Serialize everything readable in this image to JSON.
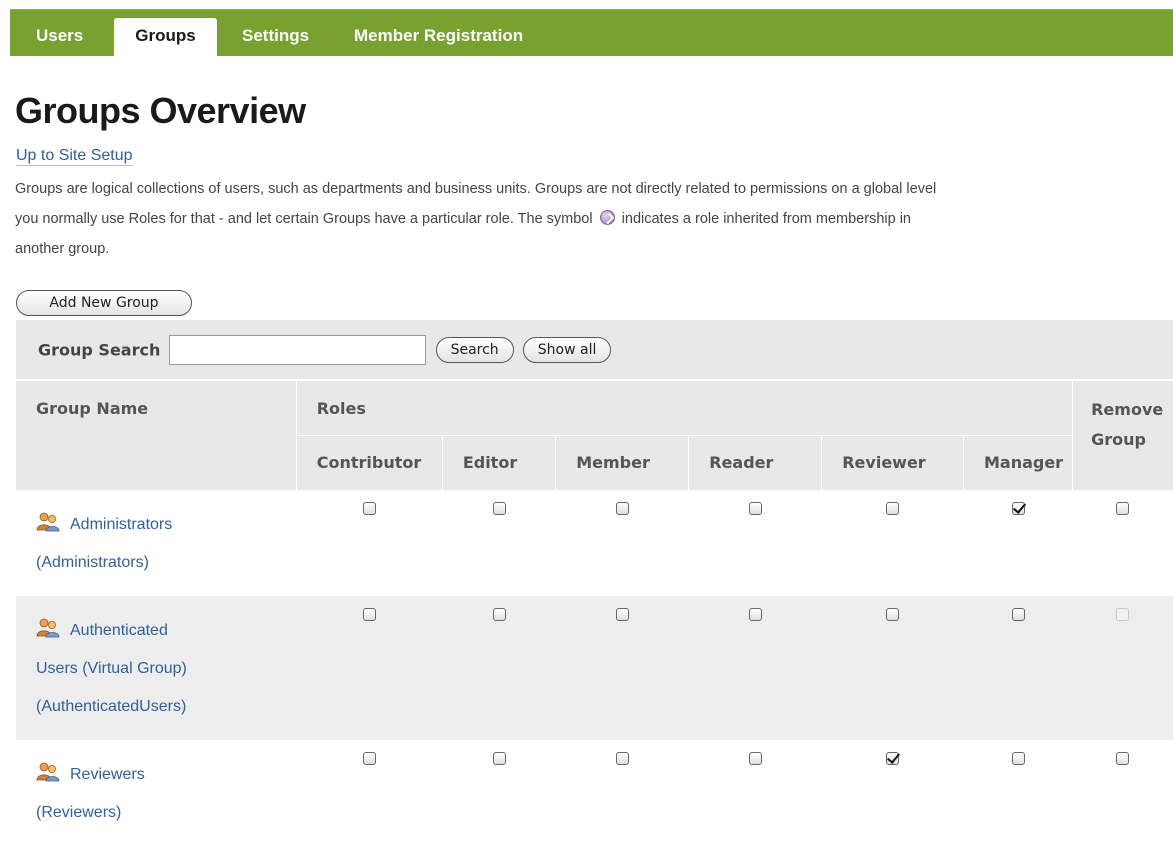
{
  "tabs": [
    {
      "label": "Users",
      "active": false
    },
    {
      "label": "Groups",
      "active": true
    },
    {
      "label": "Settings",
      "active": false
    },
    {
      "label": "Member Registration",
      "active": false
    }
  ],
  "page_title": "Groups Overview",
  "up_link": "Up to Site Setup",
  "description": {
    "line1": "Groups are logical collections of users, such as departments and business units. Groups are not directly related to permissions on a global level",
    "line2a": "you normally use Roles for that - and let certain Groups have a particular role. The symbol",
    "line2b": "indicates a role inherited from membership in",
    "line3": "another group."
  },
  "add_group_button": "Add New Group",
  "search": {
    "label": "Group Search",
    "value": "",
    "search_button": "Search",
    "show_all_button": "Show all"
  },
  "table": {
    "col_group_name": "Group Name",
    "col_roles": "Roles",
    "col_remove": "Remove Group",
    "role_columns": [
      "Contributor",
      "Editor",
      "Member",
      "Reader",
      "Reviewer",
      "Manager"
    ]
  },
  "groups": [
    {
      "title_lines": [
        "Administrators",
        "(Administrators)"
      ],
      "roles": [
        false,
        false,
        false,
        false,
        false,
        true
      ],
      "remove_disabled": false
    },
    {
      "title_lines": [
        "Authenticated",
        "Users (Virtual Group)",
        "(AuthenticatedUsers)"
      ],
      "roles": [
        false,
        false,
        false,
        false,
        false,
        false
      ],
      "remove_disabled": true
    },
    {
      "title_lines": [
        "Reviewers",
        "(Reviewers)"
      ],
      "roles": [
        false,
        false,
        false,
        false,
        true,
        false
      ],
      "remove_disabled": false
    }
  ],
  "colors": {
    "tabbar": "#78a22f",
    "link": "#2f5fa0",
    "header_bg": "#e8e8e8"
  },
  "icons": {
    "group": "group-users-icon",
    "inherited_role": "inherited-role-icon"
  }
}
